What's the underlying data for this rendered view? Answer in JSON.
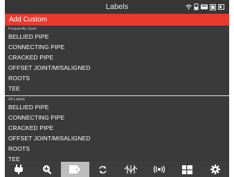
{
  "header": {
    "title": "Labels"
  },
  "add_custom": {
    "label": "Add Custom"
  },
  "frequently_used": {
    "heading": "Frequently Used",
    "items": [
      "BELLIED PIPE",
      "CONNECTING PIPE",
      "CRACKED PIPE",
      "OFFSET JOINT/MISALIGNED",
      "ROOTS",
      "TEE"
    ]
  },
  "all_labels": {
    "heading": "All Labels",
    "items": [
      "BELLIED PIPE",
      "CONNECTING PIPE",
      "CRACKED PIPE",
      "OFFSET JOINT/MISALIGNED",
      "ROOTS",
      "TEE"
    ]
  },
  "status_icons": [
    "wifi-icon",
    "usb-icon",
    "storage-icon",
    "sd-card-icon",
    "battery-icon"
  ],
  "bottom_tabs": [
    {
      "icon": "plug-icon",
      "active": false
    },
    {
      "icon": "zoom-in-icon",
      "active": false
    },
    {
      "icon": "label-tag-icon",
      "active": true
    },
    {
      "icon": "rotate-icon",
      "active": false
    },
    {
      "icon": "sonde-icon",
      "active": false
    },
    {
      "icon": "transmitter-icon",
      "active": false
    },
    {
      "icon": "layout-icon",
      "active": false
    },
    {
      "icon": "settings-gear-icon",
      "active": false
    }
  ],
  "colors": {
    "accent": "#e83a2f",
    "background": "#3a3a3a",
    "active_tab": "#bdbdbd"
  }
}
